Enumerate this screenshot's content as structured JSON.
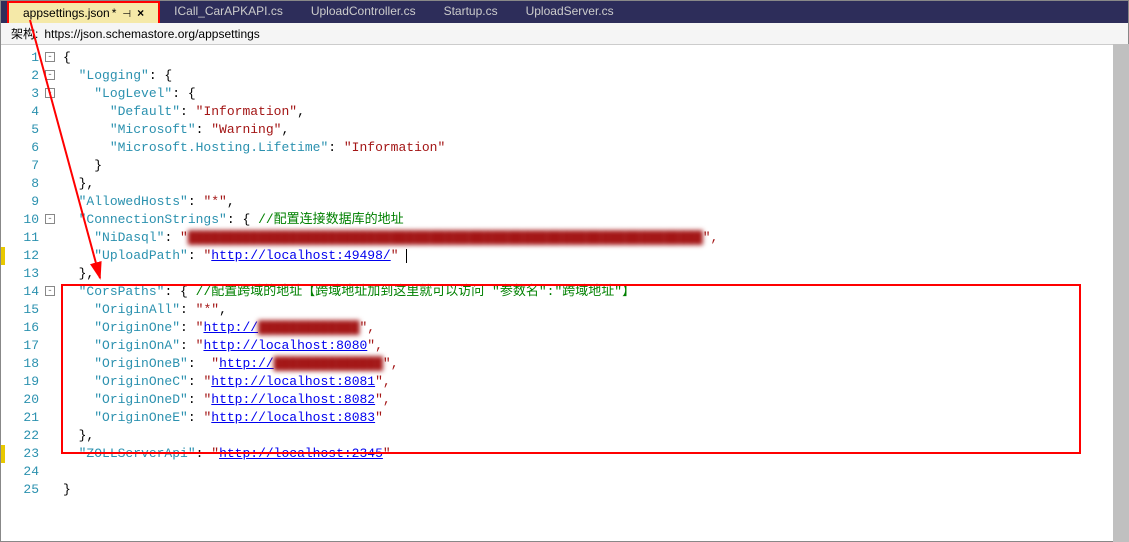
{
  "tabs": [
    {
      "label": "appsettings.json",
      "modified": "*",
      "pin": "⊣",
      "close": "×",
      "active": true
    },
    {
      "label": "ICall_CarAPKAPI.cs",
      "active": false
    },
    {
      "label": "UploadController.cs",
      "active": false
    },
    {
      "label": "Startup.cs",
      "active": false
    },
    {
      "label": "UploadServer.cs",
      "active": false
    }
  ],
  "schema": {
    "label": "架构:",
    "url": "https://json.schemastore.org/appsettings"
  },
  "lines": {
    "l1": "{",
    "l2a": "\"Logging\"",
    "l2b": ": {",
    "l3a": "\"LogLevel\"",
    "l3b": ": {",
    "l4a": "\"Default\"",
    "l4b": ": ",
    "l4c": "\"Information\"",
    "l4d": ",",
    "l5a": "\"Microsoft\"",
    "l5b": ": ",
    "l5c": "\"Warning\"",
    "l5d": ",",
    "l6a": "\"Microsoft.Hosting.Lifetime\"",
    "l6b": ": ",
    "l6c": "\"Information\"",
    "l7": "}",
    "l8": "},",
    "l9a": "\"AllowedHosts\"",
    "l9b": ": ",
    "l9c": "\"*\"",
    "l9d": ",",
    "l10a": "\"ConnectionStrings\"",
    "l10b": ": { ",
    "l10c": "//配置连接数据库的地址",
    "l11a": "\"NiDasql\"",
    "l11b": ": ",
    "l11c": "\"",
    "l11blur": "██████████████████████████████████████████████████████████████████",
    "l11e": "\",",
    "l12a": "\"UploadPath\"",
    "l12b": ": ",
    "l12c": "\"",
    "l12d": "http://localhost:49498/",
    "l12e": "\"",
    "l13": "},",
    "l14a": "\"CorsPaths\"",
    "l14b": ": { ",
    "l14c": "//配置跨域的地址【跨域地址加到这里就可以访问 \"参数名\":\"跨域地址\"】",
    "l15a": "\"OriginAll\"",
    "l15b": ": ",
    "l15c": "\"*\"",
    "l15d": ",",
    "l16a": "\"OriginOne\"",
    "l16b": ": ",
    "l16c": "\"",
    "l16d": "http://",
    "l16blur": "█████████████",
    "l16e": "\",",
    "l17a": "\"OriginOnA\"",
    "l17b": ": ",
    "l17c": "\"",
    "l17d": "http://localhost:8080",
    "l17e": "\",",
    "l18a": "\"OriginOneB\"",
    "l18b": ":  ",
    "l18c": "\"",
    "l18d": "http://",
    "l18blur": "██████████████",
    "l18e": "\",",
    "l19a": "\"OriginOneC\"",
    "l19b": ": ",
    "l19c": "\"",
    "l19d": "http://localhost:8081",
    "l19e": "\",",
    "l20a": "\"OriginOneD\"",
    "l20b": ": ",
    "l20c": "\"",
    "l20d": "http://localhost:8082",
    "l20e": "\",",
    "l21a": "\"OriginOneE\"",
    "l21b": ": ",
    "l21c": "\"",
    "l21d": "http://localhost:8083",
    "l21e": "\"",
    "l22": "},",
    "l23a": "\"ZOLLServerApi\"",
    "l23b": ": ",
    "l23c": "\"",
    "l23d": "http://localhost:2345",
    "l23e": "\"",
    "l25": "}"
  },
  "lineNumbers": [
    "1",
    "2",
    "3",
    "4",
    "5",
    "6",
    "7",
    "8",
    "9",
    "10",
    "11",
    "12",
    "13",
    "14",
    "15",
    "16",
    "17",
    "18",
    "19",
    "20",
    "21",
    "22",
    "23",
    "24",
    "25"
  ]
}
